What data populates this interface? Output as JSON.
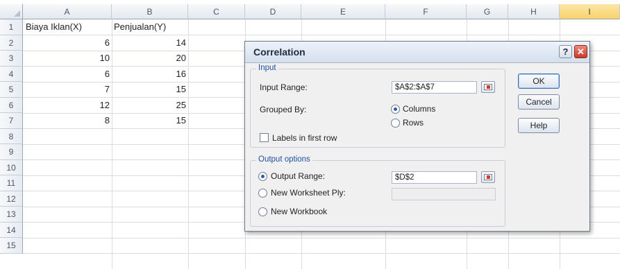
{
  "sheet": {
    "columns": [
      "A",
      "B",
      "C",
      "D",
      "E",
      "F",
      "G",
      "H",
      "I"
    ],
    "rows": [
      "1",
      "2",
      "3",
      "4",
      "5",
      "6",
      "7",
      "8",
      "9",
      "10",
      "11",
      "12",
      "13",
      "14",
      "15"
    ],
    "a1": "Biaya Iklan(X)",
    "b1": "Penjualan(Y)",
    "x_values": [
      "6",
      "10",
      "6",
      "7",
      "12",
      "8"
    ],
    "y_values": [
      "14",
      "20",
      "16",
      "15",
      "25",
      "15"
    ]
  },
  "dialog": {
    "title": "Correlation",
    "help_glyph": "?",
    "close_glyph": "✕",
    "input_group": {
      "label": "Input",
      "input_range_label": "Input Range:",
      "input_range_value": "$A$2:$A$7",
      "grouped_by_label": "Grouped By:",
      "columns_label": "Columns",
      "rows_label": "Rows",
      "grouped_by_selected": "Columns",
      "labels_checkbox_label": "Labels in first row",
      "labels_checked": false
    },
    "output_group": {
      "label": "Output options",
      "output_range_label": "Output Range:",
      "output_range_value": "$D$2",
      "new_ply_label": "New Worksheet Ply:",
      "new_ply_value": "",
      "new_workbook_label": "New Workbook",
      "selected": "Output Range"
    },
    "buttons": {
      "ok": "OK",
      "cancel": "Cancel",
      "help": "Help"
    },
    "icons": [
      "range-selector-icon",
      "help-icon",
      "close-icon"
    ]
  }
}
